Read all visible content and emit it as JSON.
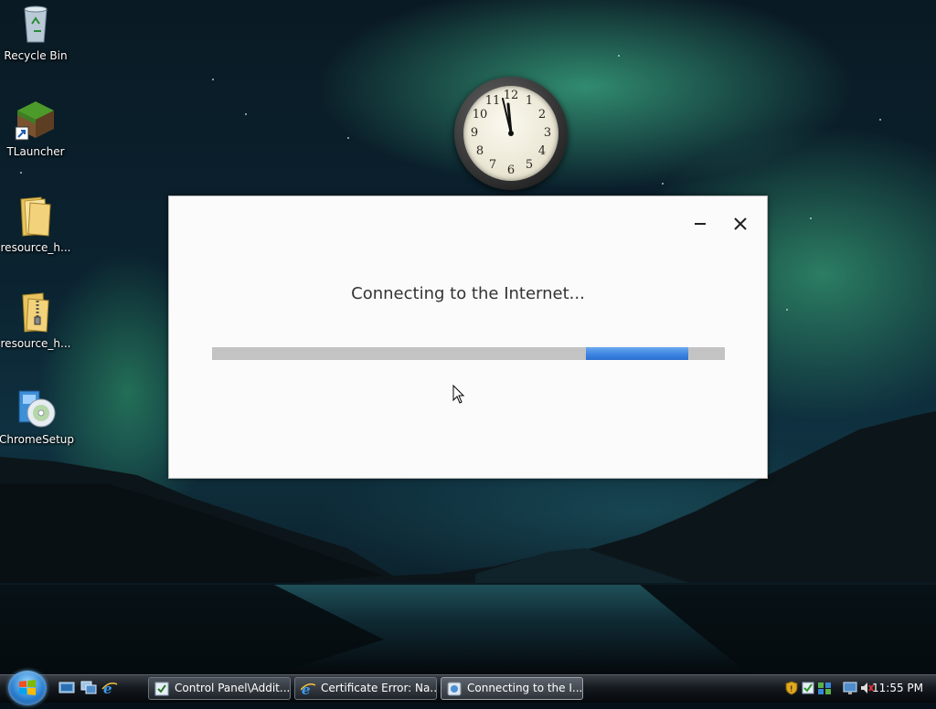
{
  "desktop": {
    "icons": [
      {
        "label": "Recycle Bin",
        "icon": "recycle-bin-icon"
      },
      {
        "label": "TLauncher",
        "icon": "minecraft-grass-block-icon"
      },
      {
        "label": "resource_h...",
        "icon": "folder-icon"
      },
      {
        "label": "resource_h...",
        "icon": "zip-folder-icon"
      },
      {
        "label": "ChromeSetup",
        "icon": "setup-cd-icon"
      }
    ],
    "clock_gadget": {
      "numbers": [
        "12",
        "1",
        "2",
        "3",
        "4",
        "5",
        "6",
        "7",
        "8",
        "9",
        "10",
        "11"
      ],
      "time": "11:55"
    }
  },
  "dialog": {
    "message": "Connecting to the Internet...",
    "minimize_symbol": "minimize-icon",
    "close_symbol": "close-icon",
    "progress": {
      "mode": "indeterminate",
      "track_color": "#c3c3c3",
      "chunk_color": "#3a82e0"
    }
  },
  "taskbar": {
    "quick_launch": [
      "show-desktop-icon",
      "switch-windows-icon",
      "internet-explorer-icon"
    ],
    "buttons": [
      {
        "label": "Control Panel\\Addit...",
        "icon": "control-panel-icon",
        "active": false
      },
      {
        "label": "Certificate Error: Na...",
        "icon": "internet-explorer-icon",
        "active": false
      },
      {
        "label": "Connecting to the I...",
        "icon": "installer-icon",
        "active": true
      }
    ],
    "tray": {
      "icons": [
        "security-shield-icon",
        "windows-update-icon",
        "network-icon",
        "display-icon",
        "volume-muted-icon"
      ],
      "time": "11:55 PM"
    }
  }
}
